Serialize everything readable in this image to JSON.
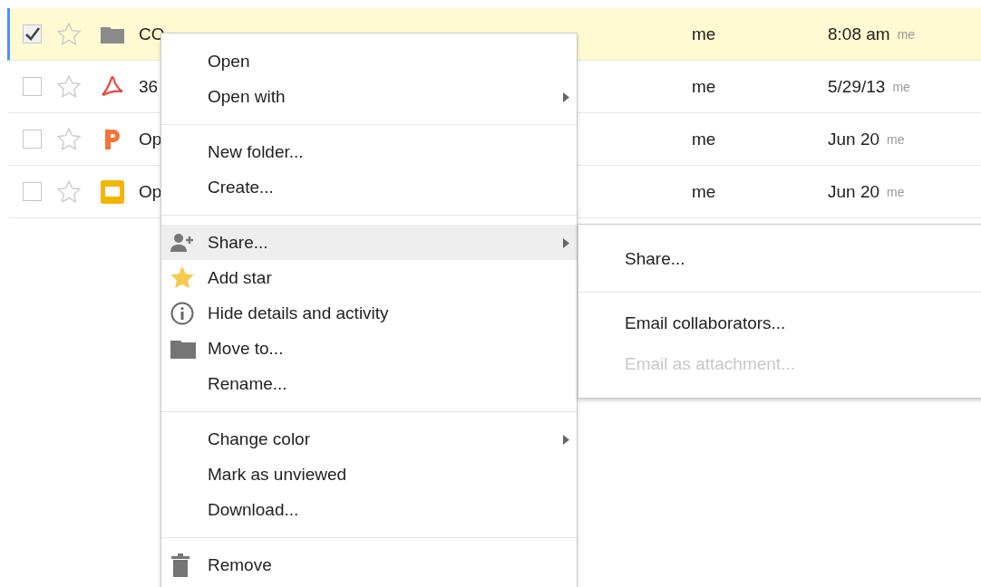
{
  "files": [
    {
      "kind": "folder",
      "name": "CO",
      "owner": "me",
      "date": "8:08 am",
      "modified_by": "me",
      "selected": true,
      "checked": true,
      "starred": false
    },
    {
      "kind": "pdf",
      "name": "36",
      "owner": "me",
      "date": "5/29/13",
      "modified_by": "me",
      "selected": false,
      "checked": false,
      "starred": false
    },
    {
      "kind": "presentation",
      "name": "Op",
      "owner": "me",
      "date": "Jun 20",
      "modified_by": "me",
      "selected": false,
      "checked": false,
      "starred": false
    },
    {
      "kind": "slides",
      "name": "Op",
      "owner": "me",
      "date": "Jun 20",
      "modified_by": "me",
      "selected": false,
      "checked": false,
      "starred": false
    }
  ],
  "context_menu": {
    "sections": [
      [
        {
          "label": "Open",
          "kind": "plain",
          "submenu": false,
          "highlighted": false
        },
        {
          "label": "Open with",
          "kind": "plain",
          "submenu": true,
          "highlighted": false
        }
      ],
      [
        {
          "label": "New folder...",
          "kind": "plain",
          "submenu": false,
          "highlighted": false
        },
        {
          "label": "Create...",
          "kind": "plain",
          "submenu": false,
          "highlighted": false
        }
      ],
      [
        {
          "label": "Share...",
          "kind": "share",
          "submenu": true,
          "highlighted": true
        },
        {
          "label": "Add star",
          "kind": "star",
          "submenu": false,
          "highlighted": false
        },
        {
          "label": "Hide details and activity",
          "kind": "info",
          "submenu": false,
          "highlighted": false
        },
        {
          "label": "Move to...",
          "kind": "move",
          "submenu": false,
          "highlighted": false
        },
        {
          "label": "Rename...",
          "kind": "plain",
          "submenu": false,
          "highlighted": false
        }
      ],
      [
        {
          "label": "Change color",
          "kind": "plain",
          "submenu": true,
          "highlighted": false
        },
        {
          "label": "Mark as unviewed",
          "kind": "plain",
          "submenu": false,
          "highlighted": false
        },
        {
          "label": "Download...",
          "kind": "plain",
          "submenu": false,
          "highlighted": false
        }
      ],
      [
        {
          "label": "Remove",
          "kind": "remove",
          "submenu": false,
          "highlighted": false
        }
      ]
    ]
  },
  "share_submenu": {
    "sections": [
      [
        {
          "label": "Share...",
          "disabled": false
        }
      ],
      [
        {
          "label": "Email collaborators...",
          "disabled": false
        },
        {
          "label": "Email as attachment...",
          "disabled": true
        }
      ]
    ]
  }
}
